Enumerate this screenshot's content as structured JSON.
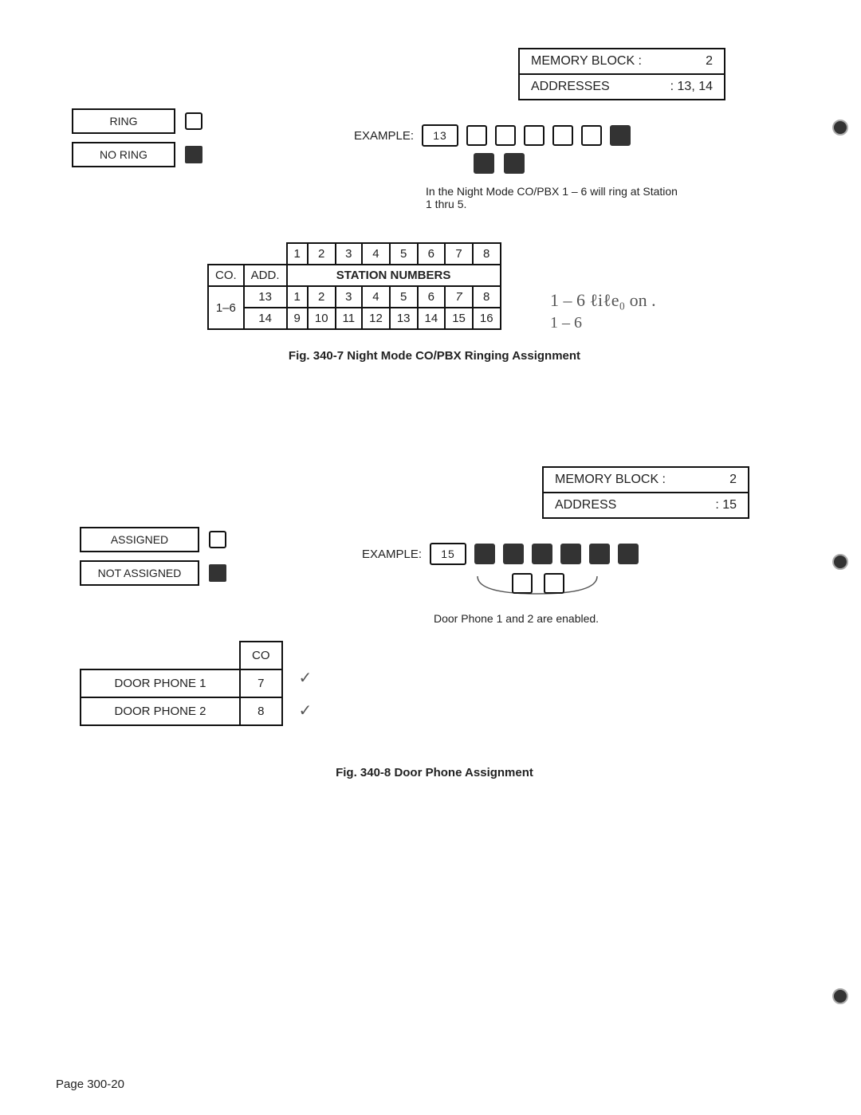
{
  "fig1": {
    "memory_block_label": "MEMORY BLOCK  :",
    "memory_block_value": "2",
    "addresses_label": "ADDRESSES",
    "addresses_value": ": 13, 14",
    "legend_ring": "RING",
    "legend_no_ring": "NO RING",
    "example_label": "EXAMPLE:",
    "ex_chip": "13",
    "ex_top": [
      "open",
      "open",
      "open",
      "open",
      "open",
      "solid"
    ],
    "ex_bottom": [
      "solid",
      "solid"
    ],
    "note": "In the Night Mode CO/PBX 1 – 6 will ring at Station 1 thru 5.",
    "table": {
      "head": [
        "1",
        "2",
        "3",
        "4",
        "5",
        "6",
        "7",
        "8"
      ],
      "co_label": "CO.",
      "add_label": "ADD.",
      "span_label": "STATION NUMBERS",
      "co_value": "1–6",
      "add_values": [
        "13",
        "14"
      ],
      "rows": [
        [
          "1",
          "2",
          "3",
          "4",
          "5",
          "6",
          "7",
          "8"
        ],
        [
          "9",
          "10",
          "11",
          "12",
          "13",
          "14",
          "15",
          "16"
        ]
      ]
    },
    "handwriting1": "1 – 6   ℓiℓe₀  on .",
    "handwriting2": "1 – 6",
    "caption": "Fig. 340-7    Night Mode CO/PBX Ringing Assignment"
  },
  "fig2": {
    "memory_block_label": "MEMORY BLOCK  :",
    "memory_block_value": "2",
    "address_label": "ADDRESS",
    "address_value": ":   15",
    "legend_assigned": "ASSIGNED",
    "legend_not_assigned": "NOT ASSIGNED",
    "example_label": "EXAMPLE:",
    "ex_chip": "15",
    "ex_top": [
      "solid",
      "solid",
      "solid",
      "solid",
      "solid",
      "solid"
    ],
    "ex_bottom": [
      "open",
      "open"
    ],
    "note": "Door Phone 1 and 2 are enabled.",
    "table": {
      "head_co": "CO",
      "rows": [
        {
          "label": "DOOR PHONE 1",
          "co": "7"
        },
        {
          "label": "DOOR PHONE 2",
          "co": "8"
        }
      ]
    },
    "caption": "Fig. 340-8    Door Phone Assignment"
  },
  "footer": "Page 300-20"
}
